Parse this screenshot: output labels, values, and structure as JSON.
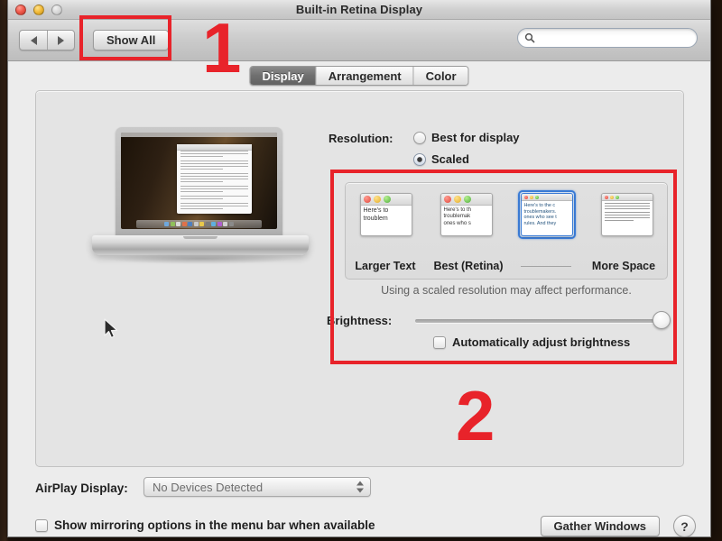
{
  "window": {
    "title": "Built-in Retina Display",
    "traffic_lights": [
      "close",
      "minimize",
      "zoom"
    ]
  },
  "toolbar": {
    "back_label": "back",
    "forward_label": "forward",
    "show_all_label": "Show All",
    "search_placeholder": "",
    "search_value": ""
  },
  "tabs": [
    {
      "label": "Display",
      "active": true
    },
    {
      "label": "Arrangement",
      "active": false
    },
    {
      "label": "Color",
      "active": false
    }
  ],
  "display_pane": {
    "resolution_label": "Resolution:",
    "options": [
      {
        "label": "Best for display",
        "selected": false
      },
      {
        "label": "Scaled",
        "selected": true
      }
    ],
    "scaled_thumbnails": [
      {
        "label": "Larger Text",
        "selected": false,
        "preview_text": [
          "Here's to",
          "troublem"
        ]
      },
      {
        "label": "Best (Retina)",
        "selected": false,
        "preview_text": [
          "Here's to th",
          "troublemak",
          "ones who s"
        ]
      },
      {
        "label": "",
        "selected": true,
        "preview_text": [
          "Here's to the c",
          "troublemakers.",
          "ones who see t",
          "rules. And they"
        ]
      },
      {
        "label": "More Space",
        "selected": false,
        "preview_text": []
      }
    ],
    "note": "Using a scaled resolution may affect performance.",
    "brightness_label": "Brightness:",
    "brightness_value": 100,
    "auto_brightness": {
      "label": "Automatically adjust brightness",
      "checked": false
    }
  },
  "bottom": {
    "airplay_label": "AirPlay Display:",
    "airplay_value": "No Devices Detected",
    "mirroring": {
      "label": "Show mirroring options in the menu bar when available",
      "checked": false
    },
    "gather_windows_label": "Gather Windows",
    "help_label": "?"
  },
  "annotations": [
    {
      "number": "1",
      "target": "show-all-button"
    },
    {
      "number": "2",
      "target": "scaled-resolution-area"
    }
  ],
  "colors": {
    "annotation_red": "#e8232a",
    "selection_blue": "#3a7bd5",
    "window_bg": "#ececec",
    "panel_bg": "#e4e4e4"
  }
}
